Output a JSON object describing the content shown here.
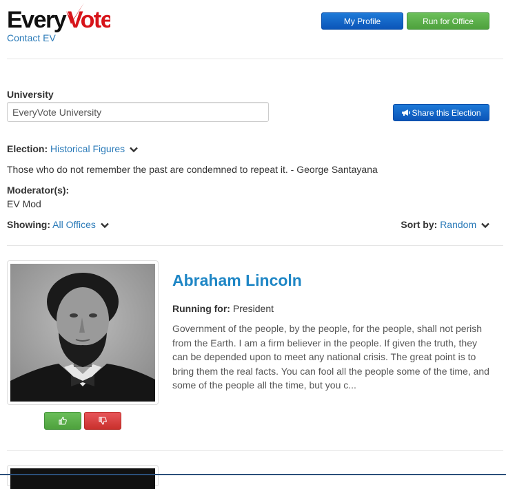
{
  "header": {
    "logo_text_black": "Every",
    "logo_text_red": "Vote",
    "contact_label": "Contact EV",
    "my_profile_label": "My Profile",
    "run_for_office_label": "Run for Office"
  },
  "university": {
    "label": "University",
    "value": "EveryVote University"
  },
  "share_label": "Share this Election",
  "election": {
    "label": "Election:",
    "value": "Historical Figures",
    "quote": "Those who do not remember the past are condemned to repeat it. - George Santayana"
  },
  "moderators": {
    "label": "Moderator(s):",
    "value": "EV Mod"
  },
  "filters": {
    "showing_label": "Showing:",
    "showing_value": "All Offices",
    "sort_label": "Sort by:",
    "sort_value": "Random"
  },
  "candidate": {
    "name": "Abraham Lincoln",
    "running_label": "Running for:",
    "running_value": "President",
    "bio": "Government of the people, by the people, for the people, shall not perish from the Earth. I am a firm believer in the people. If given the truth, they can be depended upon to meet any national crisis. The great point is to bring them the real facts. You can fool all the people some of the time, and some of the people all the time, but you c..."
  },
  "icons": {
    "share": "megaphone-icon",
    "vote_up": "thumbs-up-icon",
    "vote_down": "thumbs-down-icon",
    "dropdown": "chevron-down-icon"
  },
  "colors": {
    "brand_red": "#d7141a",
    "link_blue": "#2a7ab8",
    "name_blue": "#1e86c5",
    "primary_blue": "#0b55b8",
    "success_green": "#4ea13d",
    "danger_red": "#c9302c"
  }
}
